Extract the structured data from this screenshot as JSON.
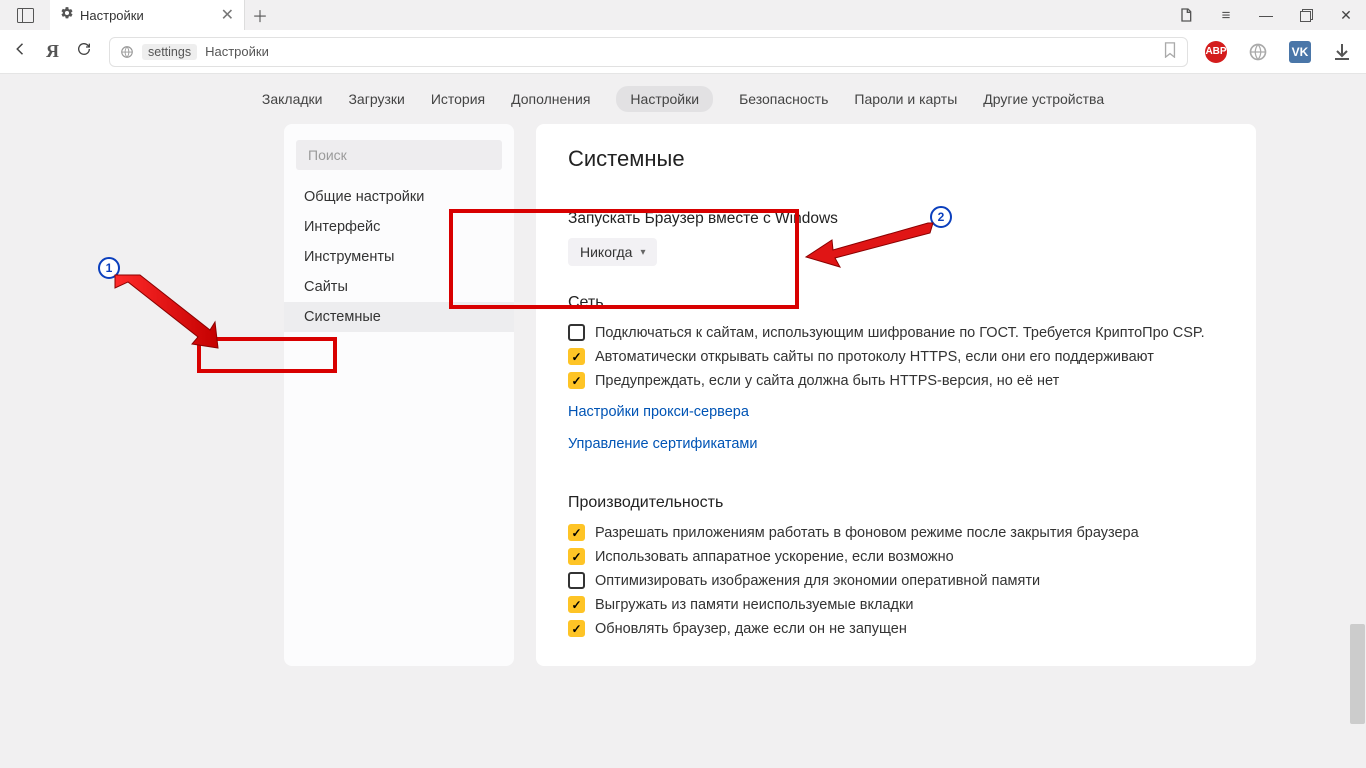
{
  "tab": {
    "title": "Настройки"
  },
  "address": {
    "host": "settings",
    "path": "Настройки"
  },
  "topnav": {
    "items": [
      "Закладки",
      "Загрузки",
      "История",
      "Дополнения",
      "Настройки",
      "Безопасность",
      "Пароли и карты",
      "Другие устройства"
    ],
    "active_index": 4
  },
  "sidebar": {
    "search_placeholder": "Поиск",
    "items": [
      "Общие настройки",
      "Интерфейс",
      "Инструменты",
      "Сайты",
      "Системные"
    ],
    "active_index": 4
  },
  "main": {
    "title": "Системные",
    "startup": {
      "label": "Запускать Браузер вместе с Windows",
      "dropdown_value": "Никогда"
    },
    "network": {
      "heading": "Сеть",
      "checks": [
        {
          "checked": false,
          "label": "Подключаться к сайтам, использующим шифрование по ГОСТ. Требуется КриптоПро CSP."
        },
        {
          "checked": true,
          "label": "Автоматически открывать сайты по протоколу HTTPS, если они его поддерживают"
        },
        {
          "checked": true,
          "label": "Предупреждать, если у сайта должна быть HTTPS-версия, но её нет"
        }
      ],
      "links": [
        "Настройки прокси-сервера",
        "Управление сертификатами"
      ]
    },
    "performance": {
      "heading": "Производительность",
      "checks": [
        {
          "checked": true,
          "label": "Разрешать приложениям работать в фоновом режиме после закрытия браузера"
        },
        {
          "checked": true,
          "label": "Использовать аппаратное ускорение, если возможно"
        },
        {
          "checked": false,
          "label": "Оптимизировать изображения для экономии оперативной памяти"
        },
        {
          "checked": true,
          "label": "Выгружать из памяти неиспользуемые вкладки"
        },
        {
          "checked": true,
          "label": "Обновлять браузер, даже если он не запущен"
        }
      ]
    }
  },
  "annotations": {
    "badge1": "1",
    "badge2": "2"
  },
  "toolbar_icons": {
    "abp": "ABP",
    "vk": "VK"
  }
}
